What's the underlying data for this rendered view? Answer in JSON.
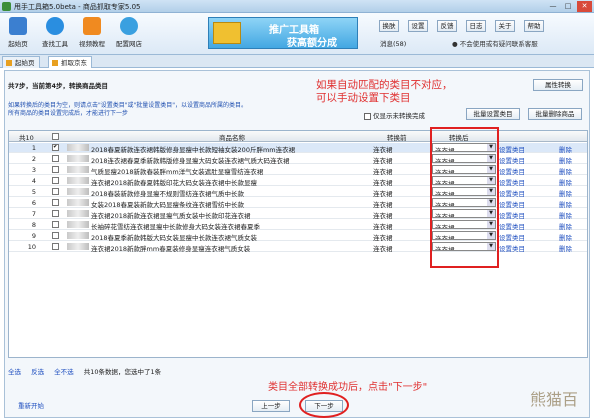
{
  "window": {
    "title": "甩手工具箱5.0beta - 商品抓取专家5.05",
    "controls": [
      "—",
      "□",
      "✕"
    ]
  },
  "toolbar": {
    "items": [
      {
        "label": "起始页",
        "icon": "home-icon",
        "color": "#3b7fd0"
      },
      {
        "label": "查找工具",
        "icon": "search-icon",
        "color": "#2a8ee0"
      },
      {
        "label": "视频教程",
        "icon": "video-icon",
        "color": "#f08a20"
      },
      {
        "label": "配置网店",
        "icon": "gear-icon",
        "color": "#3aa0e0"
      }
    ]
  },
  "banner": {
    "line1": "推广工具箱",
    "line2": "获高额分成"
  },
  "right_buttons": [
    "换肤",
    "设置",
    "反馈",
    "日志",
    "关于",
    "帮助"
  ],
  "messages": "消息(58)",
  "notice": "● 不会使用或有疑问联系客服",
  "tabs": [
    {
      "label": "起始页",
      "active": false
    },
    {
      "label": "抓取京东",
      "active": true
    }
  ],
  "step_title": "共7步，当前第4步，转换商品类目",
  "help_text": [
    "如果转换后的类目为空，则请点击\"设置类目\"或\"批量设置类目\"，以设置商品所属的类目。",
    "所有商品的类目设置完成后，才能进行下一步"
  ],
  "annotation_top": [
    "如果自动匹配的类目不对应，",
    "可以手动设置下类目"
  ],
  "annotation_bottom": "类目全部转换成功后，点击\"下一步\"",
  "buttons": {
    "attr_convert": "属性转换",
    "batch_set": "批量设置类目",
    "batch_del": "批量删除商品",
    "only_unconverted": "仅显示未转换完成",
    "prev": "上一步",
    "next": "下一步",
    "reset": "重新开始"
  },
  "grid": {
    "headers": {
      "count": "共10",
      "name": "商品名称",
      "cat_before": "转换前",
      "cat_after": "转换后"
    },
    "rows": [
      {
        "n": "1",
        "checked": true,
        "name": "2018春夏新款连衣裙韩版修身显瘦中长款短袖女装200斤胖mm连衣裙",
        "cat": "连衣裙",
        "after": "连衣裙",
        "set": "设置类目",
        "del": "删除"
      },
      {
        "n": "2",
        "checked": false,
        "name": "2018连衣裙春夏季新款韩版修身显瘦大码女装连衣裙气质大码连衣裙",
        "cat": "连衣裙",
        "after": "连衣裙",
        "set": "设置类目",
        "del": "删除"
      },
      {
        "n": "3",
        "checked": false,
        "name": "气质显瘦2018新款春装胖mm洋气女装遮肚显瘦雪纺连衣裙",
        "cat": "连衣裙",
        "after": "连衣裙",
        "set": "设置类目",
        "del": "删除"
      },
      {
        "n": "4",
        "checked": false,
        "name": "连衣裙2018新款春夏韩版印花大码女装连衣裙中长款显瘦",
        "cat": "连衣裙",
        "after": "连衣裙",
        "set": "设置类目",
        "del": "删除"
      },
      {
        "n": "5",
        "checked": false,
        "name": "2018春装新款修身显瘦不规则雪纺连衣裙气质中长款",
        "cat": "连衣裙",
        "after": "连衣裙",
        "set": "设置类目",
        "del": "删除"
      },
      {
        "n": "6",
        "checked": false,
        "name": "女装2018春夏装新款大码显瘦条纹连衣裙雪纺中长款",
        "cat": "连衣裙",
        "after": "连衣裙",
        "set": "设置类目",
        "del": "删除"
      },
      {
        "n": "7",
        "checked": false,
        "name": "连衣裙2018新款连衣裙显瘦气质女装中长款印花连衣裙",
        "cat": "连衣裙",
        "after": "连衣裙",
        "set": "设置类目",
        "del": "删除"
      },
      {
        "n": "8",
        "checked": false,
        "name": "长袖碎花雪纺连衣裙显瘦中长款修身大码女装连衣裙春夏季",
        "cat": "连衣裙",
        "after": "连衣裙",
        "set": "设置类目",
        "del": "删除"
      },
      {
        "n": "9",
        "checked": false,
        "name": "2018春夏季新款韩版大码女装显瘦中长款连衣裙气质女装",
        "cat": "连衣裙",
        "after": "连衣裙",
        "set": "设置类目",
        "del": "删除"
      },
      {
        "n": "10",
        "checked": false,
        "name": "连衣裙2018新款胖mm春夏装修身显瘦连衣裙气质女装",
        "cat": "连衣裙",
        "after": "连衣裙",
        "set": "设置类目",
        "del": "删除"
      }
    ]
  },
  "footer": {
    "select_all": "全选",
    "invert": "反选",
    "none": "全不选",
    "summary": "共10条数据，您选中了1条"
  },
  "watermark": "熊猫百"
}
